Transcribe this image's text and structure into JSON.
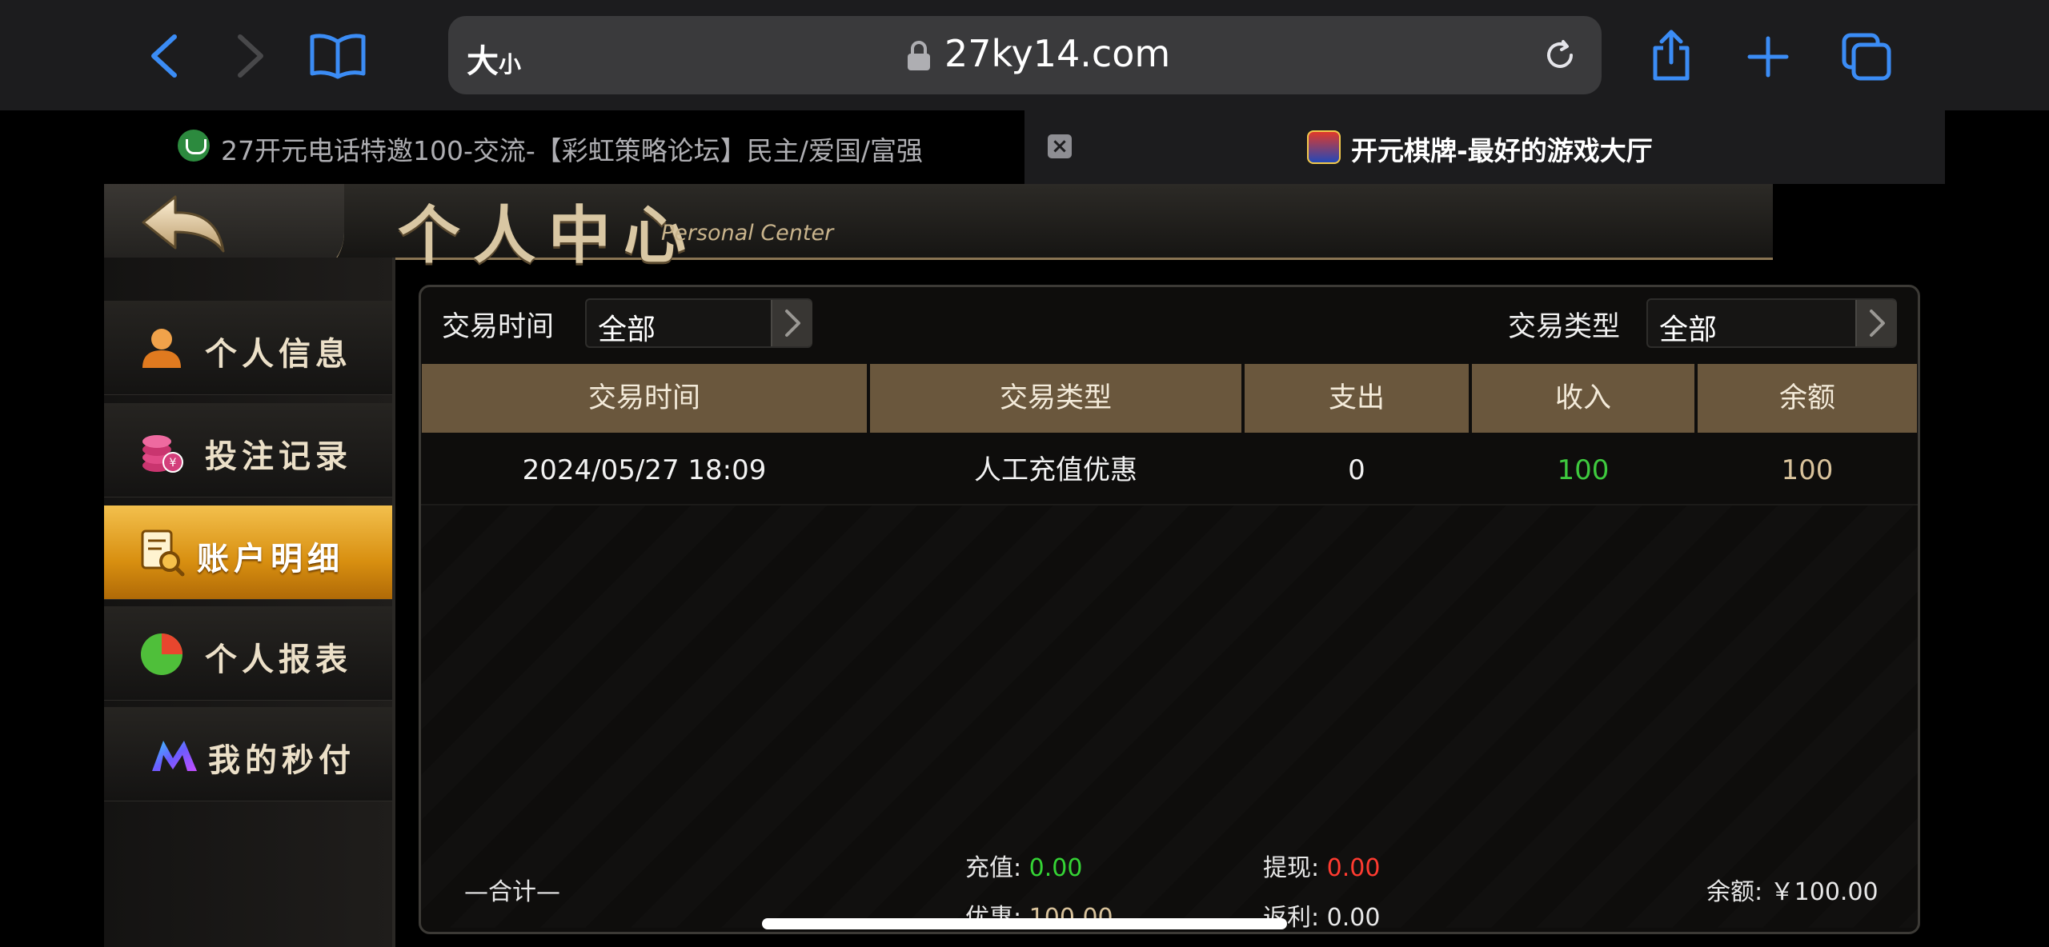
{
  "browser": {
    "text_size_label": "大",
    "text_size_label_small": "小",
    "url": "27ky14.com",
    "accent_color": "#3b8cf5"
  },
  "tabs": [
    {
      "title": "27开元电话特邀100-交流-【彩虹策略论坛】民主/爱国/富强",
      "active": false
    },
    {
      "title": "开元棋牌-最好的游戏大厅",
      "active": true
    }
  ],
  "header": {
    "title": "个人中心",
    "subtitle": "Personal Center"
  },
  "sidebar": {
    "items": [
      {
        "label": "个人信息",
        "icon": "user-icon",
        "active": false
      },
      {
        "label": "投注记录",
        "icon": "coin-stack-icon",
        "active": false
      },
      {
        "label": "账户明细",
        "icon": "account-detail-icon",
        "active": true
      },
      {
        "label": "个人报表",
        "icon": "pie-chart-icon",
        "active": false
      },
      {
        "label": "我的秒付",
        "icon": "m-logo-icon",
        "active": false
      }
    ]
  },
  "filters": {
    "time": {
      "label": "交易时间",
      "value": "全部"
    },
    "type": {
      "label": "交易类型",
      "value": "全部"
    }
  },
  "table": {
    "columns": [
      "交易时间",
      "交易类型",
      "支出",
      "收入",
      "余额"
    ],
    "rows": [
      {
        "time": "2024/05/27 18:09",
        "type": "人工充值优惠",
        "expense": "0",
        "income": "100",
        "balance": "100"
      }
    ],
    "income_color": "#3ec93e",
    "balance_color": "#d8c29b"
  },
  "summary": {
    "total_label": "—合计—",
    "recharge_label": "充值:",
    "recharge_value": "0.00",
    "withdraw_label": "提现:",
    "withdraw_value": "0.00",
    "bonus_label": "优惠:",
    "bonus_value": "100.00",
    "rebate_label": "返利:",
    "rebate_value": "0.00",
    "balance_label": "余额:",
    "balance_value": "￥100.00",
    "green": "#35d435",
    "red": "#ff3b30"
  }
}
